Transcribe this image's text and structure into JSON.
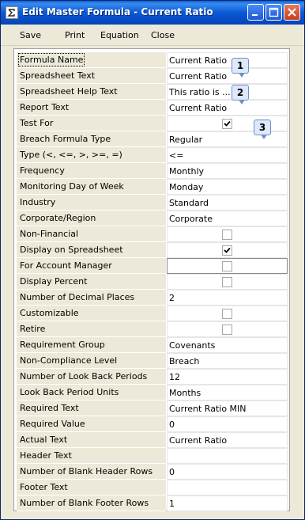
{
  "window": {
    "title": "Edit Master Formula - Current Ratio"
  },
  "menu": {
    "items": [
      "Save",
      "Print",
      "Equation",
      "Close"
    ]
  },
  "callouts": [
    "1",
    "2",
    "3"
  ],
  "rows": [
    {
      "label": "Formula Name",
      "type": "text",
      "value": "Current Ratio"
    },
    {
      "label": "Spreadsheet Text",
      "type": "text",
      "value": "Current Ratio"
    },
    {
      "label": "Spreadsheet Help Text",
      "type": "text",
      "value": "This ratio is ..."
    },
    {
      "label": "Report Text",
      "type": "text",
      "value": "Current Ratio"
    },
    {
      "label": "Test For",
      "type": "checkbox",
      "checked": true
    },
    {
      "label": "Breach Formula Type",
      "type": "text",
      "value": "Regular"
    },
    {
      "label": "Type (<, <=, >, >=, =)",
      "type": "text",
      "value": "<="
    },
    {
      "label": "Frequency",
      "type": "text",
      "value": "Monthly"
    },
    {
      "label": "Monitoring Day of Week",
      "type": "text",
      "value": "Monday"
    },
    {
      "label": "Industry",
      "type": "text",
      "value": "Standard"
    },
    {
      "label": "Corporate/Region",
      "type": "text",
      "value": "Corporate"
    },
    {
      "label": "Non-Financial",
      "type": "checkbox",
      "checked": false
    },
    {
      "label": "Display on Spreadsheet",
      "type": "checkbox",
      "checked": true
    },
    {
      "label": "For Account Manager",
      "type": "checkbox",
      "checked": false
    },
    {
      "label": "Display Percent",
      "type": "checkbox",
      "checked": false
    },
    {
      "label": "Number of Decimal Places",
      "type": "text",
      "value": "2"
    },
    {
      "label": "Customizable",
      "type": "checkbox",
      "checked": false
    },
    {
      "label": "Retire",
      "type": "checkbox",
      "checked": false
    },
    {
      "label": "Requirement Group",
      "type": "text",
      "value": "Covenants"
    },
    {
      "label": "Non-Compliance Level",
      "type": "text",
      "value": "Breach"
    },
    {
      "label": "Number of Look Back Periods",
      "type": "text",
      "value": "12"
    },
    {
      "label": "Look Back Period Units",
      "type": "text",
      "value": "Months"
    },
    {
      "label": "Required Text",
      "type": "text",
      "value": "Current Ratio MIN"
    },
    {
      "label": "Required Value",
      "type": "text",
      "value": "0"
    },
    {
      "label": "Actual Text",
      "type": "text",
      "value": "Current Ratio"
    },
    {
      "label": "Header Text",
      "type": "text",
      "value": ""
    },
    {
      "label": "Number of Blank Header Rows",
      "type": "text",
      "value": "0"
    },
    {
      "label": "Footer Text",
      "type": "text",
      "value": ""
    },
    {
      "label": "Number of Blank Footer Rows",
      "type": "text",
      "value": "1"
    }
  ]
}
